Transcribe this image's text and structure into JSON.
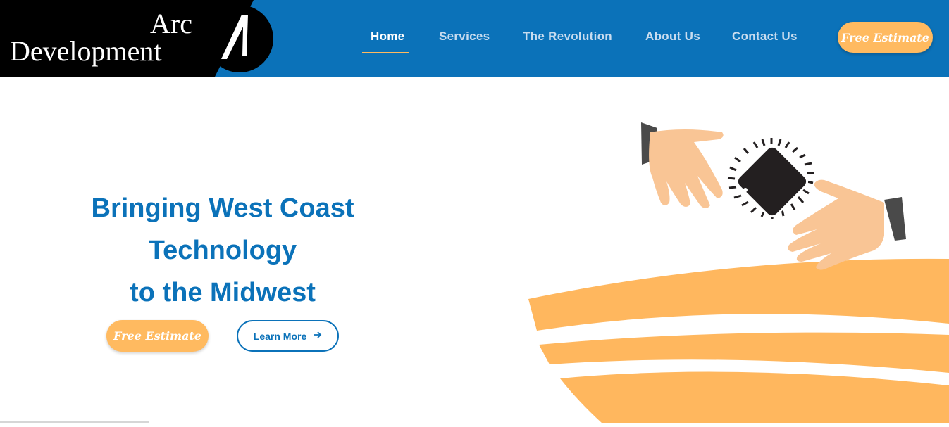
{
  "brand": {
    "line1": "Arc",
    "line2": "Development",
    "logo_icon": "arc-logo-icon",
    "colors": {
      "header": "#0b72b9",
      "accent": "#ffba60",
      "logo_bg": "#000000"
    }
  },
  "nav": {
    "items": [
      {
        "label": "Home",
        "active": true
      },
      {
        "label": "Services",
        "active": false
      },
      {
        "label": "The Revolution",
        "active": false
      },
      {
        "label": "About Us",
        "active": false
      },
      {
        "label": "Contact Us",
        "active": false
      }
    ],
    "estimate_label": "Free Estimate"
  },
  "hero": {
    "title_line1": "Bringing West Coast",
    "title_line2": "Technology",
    "title_line3": "to the Midwest",
    "estimate_label": "Free Estimate",
    "learn_more_label": "Learn More",
    "learn_more_icon": "arrow-right-icon",
    "illustration": "hands-exchanging-chip-illustration"
  }
}
